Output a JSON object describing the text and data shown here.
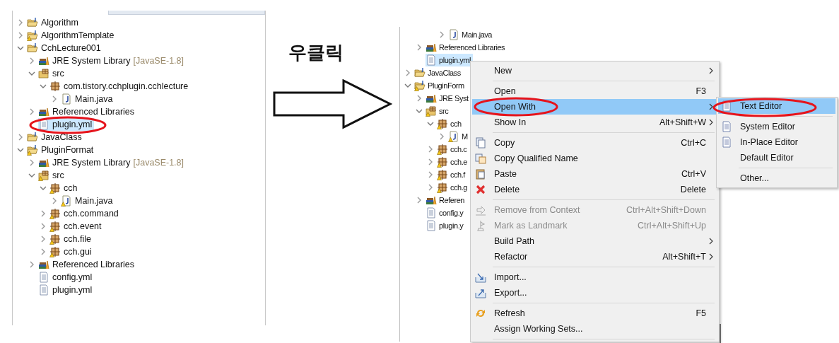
{
  "left_panel": {
    "tree": [
      {
        "kind": "project",
        "label": "Algorithm",
        "expanded": false,
        "warning": false,
        "selected": false
      },
      {
        "kind": "project",
        "label": "AlgorithmTemplate",
        "expanded": false,
        "warning": true,
        "selected": false
      },
      {
        "kind": "project",
        "label": "CchLecture001",
        "expanded": true,
        "warning": false,
        "selected": false,
        "children": [
          {
            "kind": "library",
            "label": "JRE System Library",
            "suffix": "[JavaSE-1.8]",
            "expanded": false,
            "warning": false,
            "selected": false
          },
          {
            "kind": "source-folder",
            "label": "src",
            "expanded": true,
            "warning": false,
            "selected": false,
            "children": [
              {
                "kind": "package",
                "label": "com.tistory.cchplugin.cchlecture",
                "expanded": true,
                "warning": false,
                "selected": false,
                "children": [
                  {
                    "kind": "java-file",
                    "label": "Main.java",
                    "expanded": false,
                    "warning": false,
                    "selected": false
                  }
                ]
              }
            ]
          },
          {
            "kind": "library",
            "label": "Referenced Libraries",
            "expanded": false,
            "warning": false,
            "selected": false
          },
          {
            "kind": "file",
            "label": "plugin.yml",
            "warning": false,
            "selected": true
          }
        ]
      },
      {
        "kind": "project",
        "label": "JavaClass",
        "expanded": false,
        "warning": false,
        "selected": false
      },
      {
        "kind": "project",
        "label": "PluginFormat",
        "expanded": true,
        "warning": true,
        "selected": false,
        "children": [
          {
            "kind": "library",
            "label": "JRE System Library",
            "suffix": "[JavaSE-1.8]",
            "expanded": false,
            "warning": false,
            "selected": false
          },
          {
            "kind": "source-folder",
            "label": "src",
            "expanded": true,
            "warning": true,
            "selected": false,
            "children": [
              {
                "kind": "package",
                "label": "cch",
                "expanded": true,
                "warning": true,
                "selected": false,
                "children": [
                  {
                    "kind": "java-file",
                    "label": "Main.java",
                    "expanded": false,
                    "warning": true,
                    "selected": false
                  }
                ]
              },
              {
                "kind": "package",
                "label": "cch.command",
                "expanded": false,
                "warning": true,
                "selected": false
              },
              {
                "kind": "package",
                "label": "cch.event",
                "expanded": false,
                "warning": true,
                "selected": false
              },
              {
                "kind": "package",
                "label": "cch.file",
                "expanded": false,
                "warning": true,
                "selected": false
              },
              {
                "kind": "package",
                "label": "cch.gui",
                "expanded": false,
                "warning": true,
                "selected": false
              }
            ]
          },
          {
            "kind": "library",
            "label": "Referenced Libraries",
            "expanded": false,
            "warning": false,
            "selected": false
          },
          {
            "kind": "file",
            "label": "config.yml",
            "warning": false,
            "selected": false
          },
          {
            "kind": "file",
            "label": "plugin.yml",
            "warning": false,
            "selected": false
          }
        ]
      }
    ]
  },
  "caption": "우클릭",
  "right_panel": {
    "tree": [
      {
        "children": [
          {
            "children": [
              {
                "children": [
                  {
                    "kind": "java-file",
                    "label": "Main.java",
                    "expanded": false,
                    "warning": false,
                    "selected": false
                  }
                ]
              }
            ]
          },
          {
            "kind": "library",
            "label": "Referenced Libraries",
            "expanded": false,
            "warning": false,
            "selected": false
          },
          {
            "kind": "file",
            "label": "plugin.yml",
            "warning": false,
            "selected": true
          }
        ]
      },
      {
        "kind": "project",
        "label": "JavaClass",
        "expanded": false,
        "warning": false,
        "selected": false
      },
      {
        "kind": "project",
        "label": "PluginForm",
        "expanded": true,
        "warning": true,
        "selected": false,
        "children": [
          {
            "kind": "library",
            "label": "JRE Syst",
            "expanded": false,
            "warning": false,
            "selected": false
          },
          {
            "kind": "source-folder",
            "label": "src",
            "expanded": true,
            "warning": true,
            "selected": false,
            "children": [
              {
                "kind": "package",
                "label": "cch",
                "expanded": true,
                "warning": true,
                "selected": false,
                "children": [
                  {
                    "kind": "java-file",
                    "label": "M",
                    "expanded": false,
                    "warning": true,
                    "selected": false
                  }
                ]
              },
              {
                "kind": "package",
                "label": "cch.c",
                "expanded": false,
                "warning": true,
                "selected": false
              },
              {
                "kind": "package",
                "label": "cch.e",
                "expanded": false,
                "warning": true,
                "selected": false
              },
              {
                "kind": "package",
                "label": "cch.f",
                "expanded": false,
                "warning": true,
                "selected": false
              },
              {
                "kind": "package",
                "label": "cch.g",
                "expanded": false,
                "warning": true,
                "selected": false
              }
            ]
          },
          {
            "kind": "library",
            "label": "Referen",
            "expanded": false,
            "warning": false,
            "selected": false
          },
          {
            "kind": "file",
            "label": "config.y",
            "warning": false,
            "selected": false
          },
          {
            "kind": "file",
            "label": "plugin.y",
            "warning": false,
            "selected": false
          }
        ]
      }
    ]
  },
  "context_menu": {
    "items": [
      {
        "kind": "item",
        "label": "New",
        "submenu": true,
        "disabled": false,
        "selected": false
      },
      {
        "kind": "separator"
      },
      {
        "kind": "item",
        "label": "Open",
        "shortcut": "F3",
        "submenu": false,
        "disabled": false,
        "selected": false
      },
      {
        "kind": "item",
        "label": "Open With",
        "submenu": true,
        "disabled": false,
        "selected": true
      },
      {
        "kind": "item",
        "label": "Show In",
        "shortcut": "Alt+Shift+W",
        "submenu": true,
        "disabled": false,
        "selected": false
      },
      {
        "kind": "separator"
      },
      {
        "kind": "item",
        "label": "Copy",
        "shortcut": "Ctrl+C",
        "submenu": false,
        "disabled": false,
        "selected": false
      },
      {
        "kind": "item",
        "label": "Copy Qualified Name",
        "submenu": false,
        "disabled": false,
        "selected": false
      },
      {
        "kind": "item",
        "label": "Paste",
        "shortcut": "Ctrl+V",
        "submenu": false,
        "disabled": false,
        "selected": false
      },
      {
        "kind": "item",
        "label": "Delete",
        "shortcut": "Delete",
        "submenu": false,
        "disabled": false,
        "selected": false
      },
      {
        "kind": "separator"
      },
      {
        "kind": "item",
        "label": "Remove from Context",
        "shortcut": "Ctrl+Alt+Shift+Down",
        "submenu": false,
        "disabled": true,
        "selected": false
      },
      {
        "kind": "item",
        "label": "Mark as Landmark",
        "shortcut": "Ctrl+Alt+Shift+Up",
        "submenu": false,
        "disabled": true,
        "selected": false
      },
      {
        "kind": "item",
        "label": "Build Path",
        "submenu": true,
        "disabled": false,
        "selected": false
      },
      {
        "kind": "item",
        "label": "Refactor",
        "shortcut": "Alt+Shift+T",
        "submenu": true,
        "disabled": false,
        "selected": false
      },
      {
        "kind": "separator"
      },
      {
        "kind": "item",
        "label": "Import...",
        "submenu": false,
        "disabled": false,
        "selected": false
      },
      {
        "kind": "item",
        "label": "Export...",
        "submenu": false,
        "disabled": false,
        "selected": false
      },
      {
        "kind": "separator"
      },
      {
        "kind": "item",
        "label": "Refresh",
        "shortcut": "F5",
        "submenu": false,
        "disabled": false,
        "selected": false
      },
      {
        "kind": "item",
        "label": "Assign Working Sets...",
        "submenu": false,
        "disabled": false,
        "selected": false
      },
      {
        "kind": "separator"
      }
    ]
  },
  "submenu": {
    "items": [
      {
        "kind": "item",
        "label": "Text Editor",
        "selected": true
      },
      {
        "kind": "separator"
      },
      {
        "kind": "item",
        "label": "System Editor",
        "selected": false
      },
      {
        "kind": "item",
        "label": "In-Place Editor",
        "selected": false
      },
      {
        "kind": "item",
        "label": "Default Editor",
        "selected": false
      },
      {
        "kind": "separator"
      },
      {
        "kind": "item",
        "label": "Other...",
        "selected": false
      }
    ]
  }
}
